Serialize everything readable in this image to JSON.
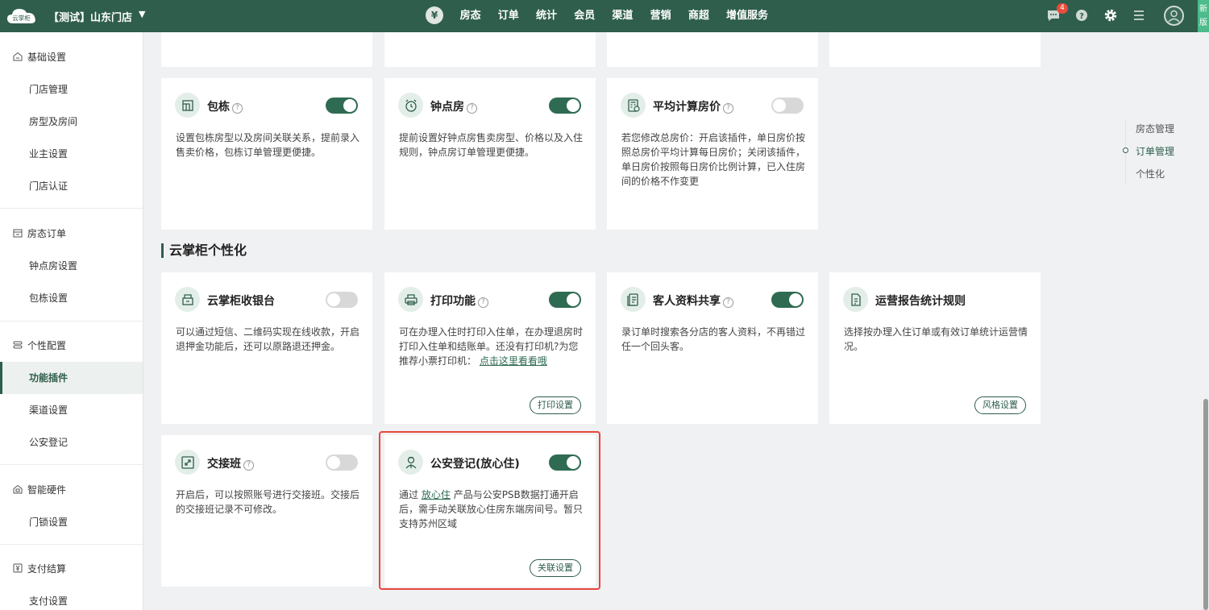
{
  "header": {
    "logo_text": "云掌柜",
    "store_name": "【测试】山东门店",
    "yen_symbol": "¥",
    "nav": [
      "房态",
      "订单",
      "统计",
      "会员",
      "渠道",
      "营销",
      "商超",
      "增值服务"
    ],
    "notification_count": "4",
    "new_version": [
      "新",
      "版"
    ],
    "icons": [
      "message-icon",
      "help-icon",
      "gear-icon",
      "menu-icon",
      "user-icon"
    ]
  },
  "sidebar": {
    "sections": [
      {
        "title": "基础设置",
        "icon": "home-icon",
        "items": [
          "门店管理",
          "房型及房间",
          "业主设置",
          "门店认证"
        ]
      },
      {
        "title": "房态订单",
        "icon": "calendar-icon",
        "items": [
          "钟点房设置",
          "包栋设置"
        ]
      },
      {
        "title": "个性配置",
        "icon": "sliders-icon",
        "items": [
          "功能插件",
          "渠道设置",
          "公安登记"
        ]
      },
      {
        "title": "智能硬件",
        "icon": "device-icon",
        "items": [
          "门锁设置"
        ]
      },
      {
        "title": "支付结算",
        "icon": "yen-icon",
        "items": [
          "支付设置"
        ]
      }
    ],
    "active_item": "功能插件"
  },
  "section_title": "云掌柜个性化",
  "cards": {
    "baodong": {
      "title": "包栋",
      "help": "?",
      "enabled": true,
      "desc": "设置包栋房型以及房间关联关系，提前录入售卖价格，包栋订单管理更便捷。"
    },
    "zhongdian": {
      "title": "钟点房",
      "help": "?",
      "enabled": true,
      "desc": "提前设置好钟点房售卖房型、价格以及入住规则，钟点房订单管理更便捷。"
    },
    "pingjun": {
      "title": "平均计算房价",
      "help": "?",
      "enabled": false,
      "desc": "若您修改总房价：开启该插件，单日房价按照总房价平均计算每日房价；关闭该插件，单日房价按照每日房价比例计算，已入住房间的价格不作变更"
    },
    "shouyin": {
      "title": "云掌柜收银台",
      "enabled": false,
      "desc": "可以通过短信、二维码实现在线收款，开启退押金功能后，还可以原路退还押金。"
    },
    "dayin": {
      "title": "打印功能",
      "help": "?",
      "enabled": true,
      "desc": "可在办理入住时打印入住单，在办理退房时打印入住单和结账单。还没有打印机?为您推荐小票打印机：",
      "link": "点击这里看看哦",
      "button": "打印设置"
    },
    "kehu": {
      "title": "客人资料共享",
      "help": "?",
      "enabled": true,
      "desc": "录订单时搜索各分店的客人资料，不再错过任一个回头客。"
    },
    "yunying": {
      "title": "运营报告统计规则",
      "desc": "选择按办理入住订单或有效订单统计运营情况。",
      "button": "风格设置"
    },
    "jiaojie": {
      "title": "交接班",
      "help": "?",
      "enabled": false,
      "desc": "开启后，可以按照账号进行交接班。交接后的交接班记录不可修改。"
    },
    "gongan": {
      "title": "公安登记(放心住)",
      "enabled": true,
      "desc_pre": "通过",
      "link": "放心住",
      "desc_post": "产品与公安PSB数据打通开启后，需手动关联放心住房东端房间号。暂只支持苏州区域",
      "button": "关联设置"
    }
  },
  "anchor_nav": {
    "items": [
      "房态管理",
      "订单管理",
      "个性化"
    ],
    "active": "订单管理"
  },
  "colors": {
    "primary": "#2f5e4c",
    "toggle_on": "#2f6b52",
    "highlight": "#e8463a",
    "badge": "#e74c3c"
  }
}
